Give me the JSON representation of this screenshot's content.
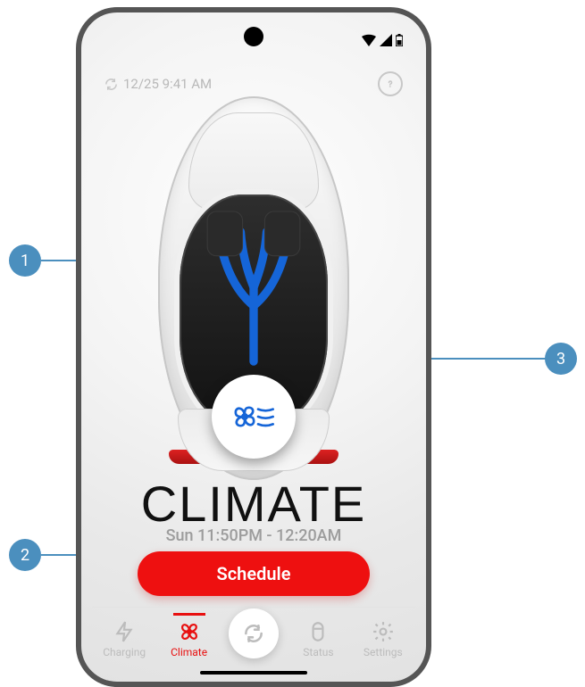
{
  "status": {
    "timestamp": "12/25 9:41 AM"
  },
  "main": {
    "title": "CLIMATE",
    "subtitle": "Sun 11:50PM - 12:20AM",
    "schedule_label": "Schedule"
  },
  "tabs": {
    "charging": "Charging",
    "climate": "Climate",
    "status": "Status",
    "settings": "Settings",
    "active": "climate"
  },
  "callouts": {
    "c1": "1",
    "c2": "2",
    "c3": "3"
  },
  "colors": {
    "accent_red": "#ee1010",
    "callout_blue": "#4b8fbe",
    "vent_blue": "#1565d8"
  }
}
